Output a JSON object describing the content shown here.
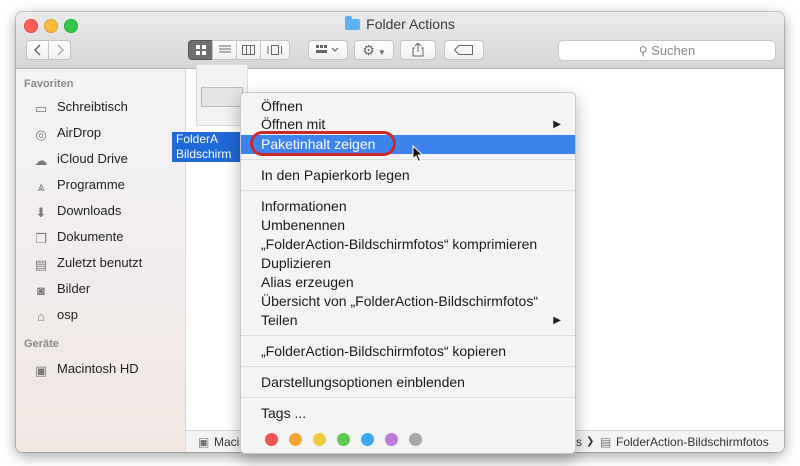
{
  "window": {
    "title": "Folder Actions"
  },
  "toolbar": {
    "back_icon": "chevron-left-icon",
    "forward_icon": "chevron-right-icon",
    "search_placeholder": "Suchen"
  },
  "sidebar": {
    "favorites_heading": "Favoriten",
    "favorites": [
      {
        "label": "Schreibtisch",
        "icon": "desktop-icon"
      },
      {
        "label": "AirDrop",
        "icon": "airdrop-icon"
      },
      {
        "label": "iCloud Drive",
        "icon": "cloud-icon"
      },
      {
        "label": "Programme",
        "icon": "applications-icon"
      },
      {
        "label": "Downloads",
        "icon": "downloads-icon"
      },
      {
        "label": "Dokumente",
        "icon": "documents-icon"
      },
      {
        "label": "Zuletzt benutzt",
        "icon": "recents-icon"
      },
      {
        "label": "Bilder",
        "icon": "camera-icon"
      },
      {
        "label": "osp",
        "icon": "home-icon"
      }
    ],
    "devices_heading": "Geräte",
    "devices": [
      {
        "label": "Macintosh HD",
        "icon": "harddrive-icon"
      }
    ]
  },
  "file": {
    "label_line1": "FolderA",
    "label_line2": "Bildschirm"
  },
  "pathbar": {
    "start": "Maci",
    "end_sep": "s",
    "current": "FolderAction-Bildschirmfotos"
  },
  "context_menu": {
    "open": "Öffnen",
    "open_with": "Öffnen mit",
    "show_package": "Paketinhalt zeigen",
    "trash": "In den Papierkorb legen",
    "info": "Informationen",
    "rename": "Umbenennen",
    "compress": "„FolderAction-Bildschirmfotos“ komprimieren",
    "duplicate": "Duplizieren",
    "alias": "Alias erzeugen",
    "quicklook": "Übersicht von „FolderAction-Bildschirmfotos“",
    "share": "Teilen",
    "copy": "„FolderAction-Bildschirmfotos“ kopieren",
    "view_options": "Darstellungsoptionen einblenden",
    "tags": "Tags ...",
    "tag_colors": [
      "#f0524f",
      "#f5a235",
      "#f2cb3d",
      "#5fc84e",
      "#3ea7f3",
      "#c07adf",
      "#a6a6a6"
    ]
  },
  "colors": {
    "highlight": "#3d83f0",
    "annotation": "#c9292b"
  }
}
